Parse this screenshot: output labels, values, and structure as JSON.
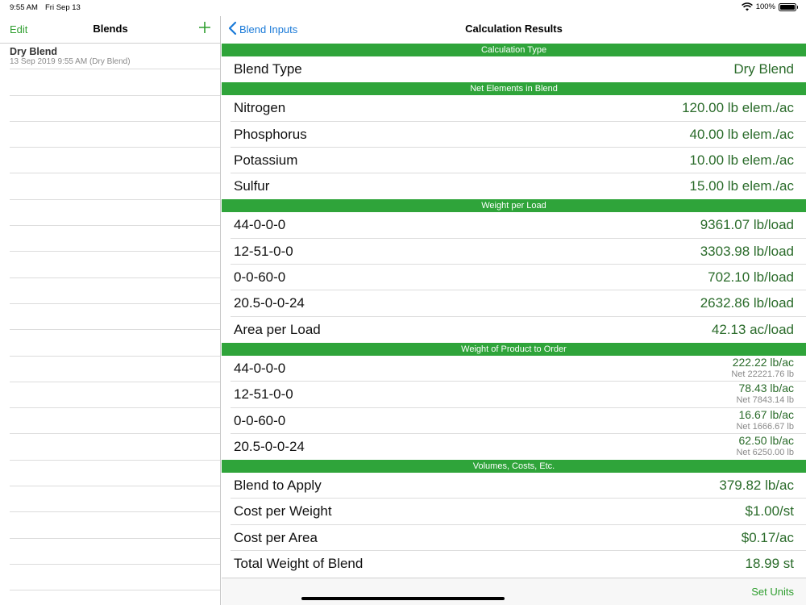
{
  "status_bar": {
    "time": "9:55 AM",
    "date": "Fri Sep 13",
    "battery": "100%",
    "battery_level": 1.0
  },
  "master": {
    "edit_label": "Edit",
    "title": "Blends",
    "add_icon": "plus-icon",
    "items": [
      {
        "name": "Dry Blend",
        "subtitle": "13 Sep 2019  9:55 AM (Dry Blend)"
      }
    ]
  },
  "detail": {
    "back_label": "Blend Inputs",
    "title": "Calculation Results",
    "sections": [
      {
        "header": "Calculation Type",
        "rows": [
          {
            "label": "Blend Type",
            "value": "Dry Blend"
          }
        ]
      },
      {
        "header": "Net Elements in Blend",
        "rows": [
          {
            "label": "Nitrogen",
            "value": "120.00 lb elem./ac"
          },
          {
            "label": "Phosphorus",
            "value": "40.00 lb elem./ac"
          },
          {
            "label": "Potassium",
            "value": "10.00 lb elem./ac"
          },
          {
            "label": "Sulfur",
            "value": "15.00 lb elem./ac"
          }
        ]
      },
      {
        "header": "Weight per Load",
        "rows": [
          {
            "label": "44-0-0-0",
            "value": "9361.07 lb/load"
          },
          {
            "label": "12-51-0-0",
            "value": "3303.98 lb/load"
          },
          {
            "label": "0-0-60-0",
            "value": "702.10 lb/load"
          },
          {
            "label": "20.5-0-0-24",
            "value": "2632.86 lb/load"
          },
          {
            "label": "Area per Load",
            "value": "42.13 ac/load"
          }
        ]
      },
      {
        "header": "Weight of Product to Order",
        "rows": [
          {
            "label": "44-0-0-0",
            "value": "222.22 lb/ac",
            "net": "Net 22221.76 lb"
          },
          {
            "label": "12-51-0-0",
            "value": "78.43 lb/ac",
            "net": "Net 7843.14 lb"
          },
          {
            "label": "0-0-60-0",
            "value": "16.67 lb/ac",
            "net": "Net 1666.67 lb"
          },
          {
            "label": "20.5-0-0-24",
            "value": "62.50 lb/ac",
            "net": "Net 6250.00 lb"
          }
        ]
      },
      {
        "header": "Volumes, Costs, Etc.",
        "rows": [
          {
            "label": "Blend to Apply",
            "value": "379.82 lb/ac"
          },
          {
            "label": "Cost per Weight",
            "value": "$1.00/st"
          },
          {
            "label": "Cost per Area",
            "value": "$0.17/ac"
          },
          {
            "label": "Total Weight of Blend",
            "value": "18.99 st"
          }
        ]
      }
    ],
    "toolbar": {
      "set_units_label": "Set Units"
    }
  },
  "colors": {
    "section_header": "#2fa43a",
    "value_text": "#2a6b2a",
    "tint_green": "#2f9e2f",
    "tint_blue": "#1a7ad8"
  }
}
